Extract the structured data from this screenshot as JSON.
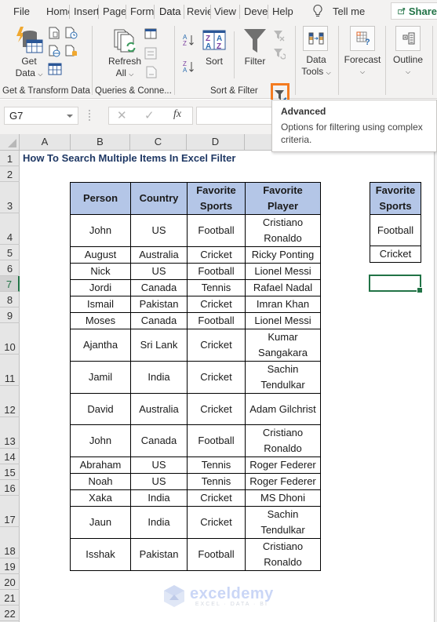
{
  "ribbon": {
    "tabs": [
      {
        "label": "File",
        "active": false
      },
      {
        "label": "Home",
        "active": false
      },
      {
        "label": "Insert",
        "active": false
      },
      {
        "label": "Page Layout",
        "active": false
      },
      {
        "label": "Formulas",
        "active": false
      },
      {
        "label": "Data",
        "active": true
      },
      {
        "label": "Review",
        "active": false
      },
      {
        "label": "View",
        "active": false
      },
      {
        "label": "Developer",
        "active": false
      },
      {
        "label": "Help",
        "active": false
      }
    ],
    "tell_me": "Tell me",
    "share": "Share",
    "groups": {
      "get_transform": {
        "label": "Get & Transform Data",
        "get_data_line1": "Get",
        "get_data_line2": "Data"
      },
      "queries": {
        "label": "Queries & Conne...",
        "refresh_line1": "Refresh",
        "refresh_line2": "All"
      },
      "sort_filter": {
        "label": "Sort & Filter",
        "sort": "Sort",
        "filter": "Filter"
      },
      "data_tools": {
        "line1": "Data",
        "line2": "Tools"
      },
      "forecast": {
        "label": "Forecast"
      },
      "outline": {
        "label": "Outline"
      }
    },
    "highlight_color": "#f47b20"
  },
  "tooltip": {
    "title": "Advanced",
    "body": "Options for filtering using complex criteria."
  },
  "formula_bar": {
    "name_box": "G7",
    "cancel_icon": "✕",
    "enter_icon": "✓",
    "fx_label": "fx",
    "value": ""
  },
  "grid": {
    "columns": [
      "A",
      "B",
      "C",
      "D"
    ],
    "rows": [
      "1",
      "2",
      "3",
      "4",
      "5",
      "6",
      "7",
      "8",
      "9",
      "10",
      "11",
      "12",
      "13",
      "14",
      "15",
      "16",
      "17",
      "18",
      "19",
      "20",
      "21",
      "22"
    ],
    "active_row": "7",
    "active_cell": "G7"
  },
  "sheet": {
    "title": "How To Search Multiple Items In Excel Filter",
    "table": {
      "headers": [
        "Person",
        "Country",
        "Favorite Sports",
        "Favorite Player"
      ],
      "rows": [
        [
          "John",
          "US",
          "Football",
          "Cristiano Ronaldo"
        ],
        [
          "August",
          "Australia",
          "Cricket",
          "Ricky Ponting"
        ],
        [
          "Nick",
          "US",
          "Football",
          "Lionel Messi"
        ],
        [
          "Jordi",
          "Canada",
          "Tennis",
          "Rafael Nadal"
        ],
        [
          "Ismail",
          "Pakistan",
          "Cricket",
          "Imran Khan"
        ],
        [
          "Moses",
          "Canada",
          "Football",
          "Lionel Messi"
        ],
        [
          "Ajantha",
          "Sri Lank",
          "Cricket",
          "Kumar Sangakara"
        ],
        [
          "Jamil",
          "India",
          "Cricket",
          "Sachin Tendulkar"
        ],
        [
          "David",
          "Australia",
          "Cricket",
          "Adam Gilchrist"
        ],
        [
          "John",
          "Canada",
          "Football",
          "Cristiano Ronaldo"
        ],
        [
          "Abraham",
          "US",
          "Tennis",
          "Roger Federer"
        ],
        [
          "Noah",
          "US",
          "Tennis",
          "Roger Federer"
        ],
        [
          "Xaka",
          "India",
          "Cricket",
          "MS Dhoni"
        ],
        [
          "Jaun",
          "India",
          "Cricket",
          "Sachin Tendulkar"
        ],
        [
          "Isshak",
          "Pakistan",
          "Football",
          "Cristiano Ronaldo"
        ]
      ]
    },
    "criteria": {
      "header": "Favorite Sports",
      "values": [
        "Football",
        "Cricket"
      ]
    },
    "header_fill": "#b4c6e7",
    "title_color": "#1f3864"
  },
  "watermark": {
    "name": "exceldemy",
    "tagline": "EXCEL · DATA · BI"
  }
}
